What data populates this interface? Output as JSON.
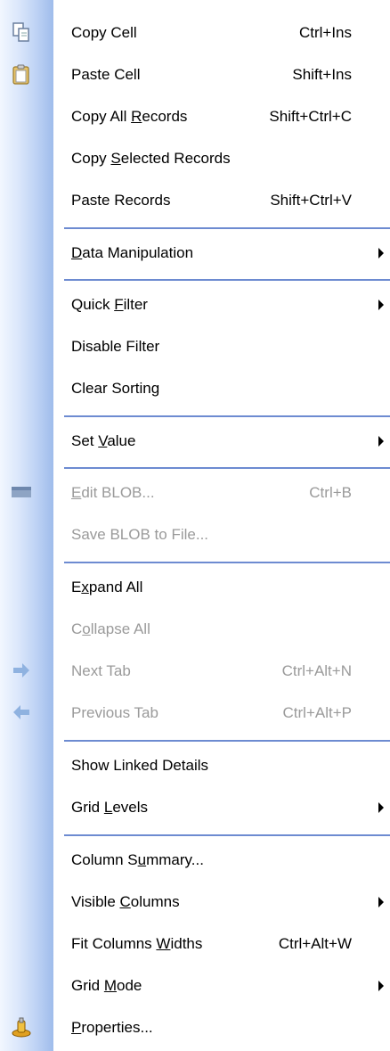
{
  "items": {
    "copy_cell": {
      "pre": "Copy Cell",
      "ul": "",
      "post": "",
      "shortcut": "Ctrl+Ins"
    },
    "paste_cell": {
      "pre": "Paste Cell",
      "ul": "",
      "post": "",
      "shortcut": "Shift+Ins"
    },
    "copy_all": {
      "pre": "Copy All ",
      "ul": "R",
      "post": "ecords",
      "shortcut": "Shift+Ctrl+C"
    },
    "copy_selected": {
      "pre": "Copy ",
      "ul": "S",
      "post": "elected Records",
      "shortcut": ""
    },
    "paste_records": {
      "pre": "Paste Records",
      "ul": "",
      "post": "",
      "shortcut": "Shift+Ctrl+V"
    },
    "data_manipulation": {
      "pre": "",
      "ul": "D",
      "post": "ata Manipulation",
      "shortcut": ""
    },
    "quick_filter": {
      "pre": "Quick ",
      "ul": "F",
      "post": "ilter",
      "shortcut": ""
    },
    "disable_filter": {
      "pre": "Disable Filter",
      "ul": "",
      "post": "",
      "shortcut": ""
    },
    "clear_sorting": {
      "pre": "Clear Sorting",
      "ul": "",
      "post": "",
      "shortcut": ""
    },
    "set_value": {
      "pre": "Set ",
      "ul": "V",
      "post": "alue",
      "shortcut": ""
    },
    "edit_blob": {
      "pre": "",
      "ul": "E",
      "post": "dit BLOB...",
      "shortcut": "Ctrl+B"
    },
    "save_blob": {
      "pre": "Save BLOB to File...",
      "ul": "",
      "post": "",
      "shortcut": ""
    },
    "expand_all": {
      "pre": "E",
      "ul": "x",
      "post": "pand All",
      "shortcut": ""
    },
    "collapse_all": {
      "pre": "C",
      "ul": "o",
      "post": "llapse All",
      "shortcut": ""
    },
    "next_tab": {
      "pre": "Next Tab",
      "ul": "",
      "post": "",
      "shortcut": "Ctrl+Alt+N"
    },
    "previous_tab": {
      "pre": "Previous Tab",
      "ul": "",
      "post": "",
      "shortcut": "Ctrl+Alt+P"
    },
    "show_linked": {
      "pre": "Show Linked Details",
      "ul": "",
      "post": "",
      "shortcut": ""
    },
    "grid_levels": {
      "pre": "Grid ",
      "ul": "L",
      "post": "evels",
      "shortcut": ""
    },
    "column_summary": {
      "pre": "Column S",
      "ul": "u",
      "post": "mmary...",
      "shortcut": ""
    },
    "visible_columns": {
      "pre": "Visible ",
      "ul": "C",
      "post": "olumns",
      "shortcut": ""
    },
    "fit_columns": {
      "pre": "Fit Columns ",
      "ul": "W",
      "post": "idths",
      "shortcut": "Ctrl+Alt+W"
    },
    "grid_mode": {
      "pre": "Grid ",
      "ul": "M",
      "post": "ode",
      "shortcut": ""
    },
    "properties": {
      "pre": "",
      "ul": "P",
      "post": "roperties...",
      "shortcut": ""
    }
  },
  "colors": {
    "separator": "#6d8bd1",
    "disabled_text": "#9a9a9a",
    "gutter": "#bcd1f4"
  }
}
